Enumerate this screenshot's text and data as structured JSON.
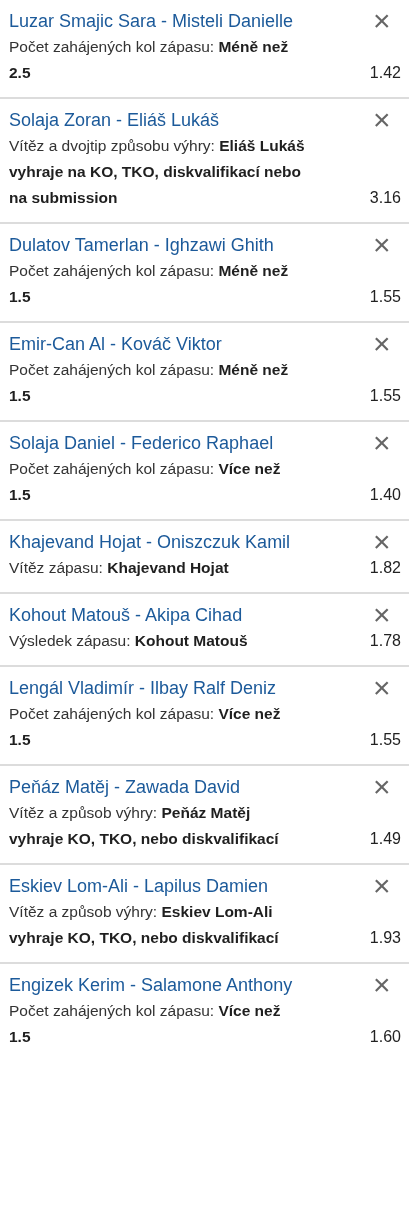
{
  "bets": [
    {
      "match": "Luzar Smajic Sara - Misteli Danielle",
      "selection": "Počet zahájených kol zápasu: **Méně než 2.5**",
      "odds": "1.42",
      "remove": "×"
    },
    {
      "match": "Solaja Zoran - Eliáš Lukáš",
      "selection": "Vítěz a dvojtip způsobu výhry: **Eliáš Lukáš vyhraje na KO, TKO, diskvalifikací nebo na submission**",
      "odds": "3.16",
      "remove": "×"
    },
    {
      "match": "Dulatov Tamerlan - Ighzawi Ghith",
      "selection": "Počet zahájených kol zápasu: **Méně než 1.5**",
      "odds": "1.55",
      "remove": "×"
    },
    {
      "match": "Emir-Can Al - Kováč Viktor",
      "selection": "Počet zahájených kol zápasu: **Méně než 1.5**",
      "odds": "1.55",
      "remove": "×"
    },
    {
      "match": "Solaja Daniel - Federico Raphael",
      "selection": "Počet zahájených kol zápasu: **Více než 1.5**",
      "odds": "1.40",
      "remove": "×"
    },
    {
      "match": "Khajevand Hojat - Oniszczuk Kamil",
      "selection": "Vítěz zápasu: **Khajevand Hojat**",
      "odds": "1.82",
      "remove": "×"
    },
    {
      "match": "Kohout Matouš - Akipa Cihad",
      "selection": "Výsledek zápasu: **Kohout Matouš**",
      "odds": "1.78",
      "remove": "×"
    },
    {
      "match": "Lengál Vladimír - Ilbay Ralf Deniz",
      "selection": "Počet zahájených kol zápasu: **Více než 1.5**",
      "odds": "1.55",
      "remove": "×"
    },
    {
      "match": "Peňáz Matěj - Zawada David",
      "selection": "Vítěz a způsob výhry: **Peňáz Matěj vyhraje KO, TKO, nebo diskvalifikací**",
      "odds": "1.49",
      "remove": "×"
    },
    {
      "match": "Eskiev Lom-Ali - Lapilus Damien",
      "selection": "Vítěz a způsob výhry: **Eskiev Lom-Ali vyhraje KO, TKO, nebo diskvalifikací**",
      "odds": "1.93",
      "remove": "×"
    },
    {
      "match": "Engizek Kerim - Salamone Anthony",
      "selection": "Počet zahájených kol zápasu: **Více než 1.5**",
      "odds": "1.60",
      "remove": "×"
    }
  ]
}
